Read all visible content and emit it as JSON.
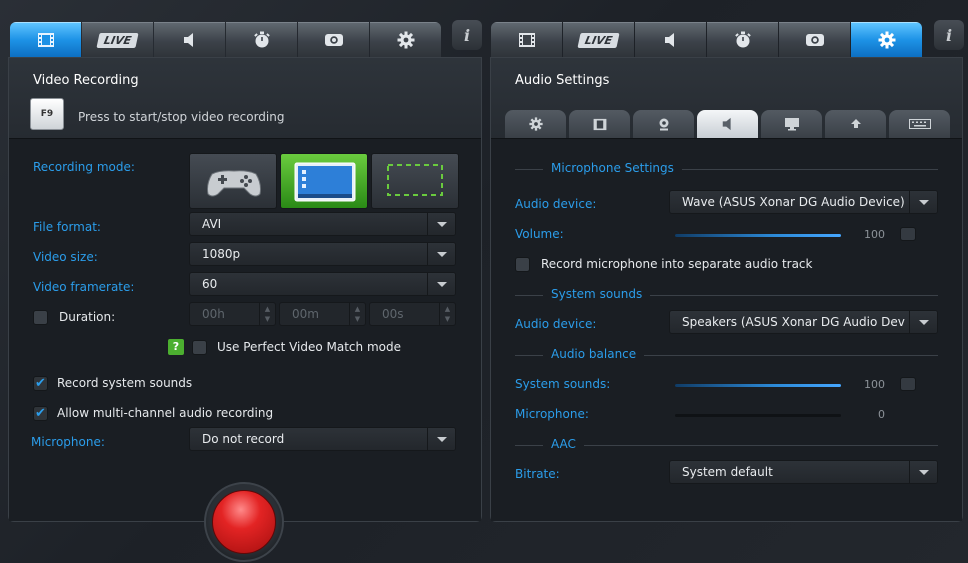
{
  "left": {
    "tabs": [
      {
        "icon": "film-icon",
        "active": true
      },
      {
        "icon": "live-icon",
        "label": "LIVE",
        "active": false
      },
      {
        "icon": "speaker-icon",
        "active": false
      },
      {
        "icon": "stopwatch-icon",
        "active": false
      },
      {
        "icon": "camera-icon",
        "active": false
      },
      {
        "icon": "gear-icon",
        "active": false
      }
    ],
    "info_label": "i",
    "title": "Video Recording",
    "hotkey": {
      "key": "F9",
      "hint": "Press to start/stop video recording"
    },
    "recording_mode": {
      "label": "Recording mode:",
      "options": [
        "game",
        "desktop",
        "region"
      ],
      "selected": "desktop"
    },
    "file_format": {
      "label": "File format:",
      "value": "AVI"
    },
    "video_size": {
      "label": "Video size:",
      "value": "1080p"
    },
    "video_framerate": {
      "label": "Video framerate:",
      "value": "60"
    },
    "duration": {
      "label": "Duration:",
      "checked": false,
      "hours": "00h",
      "minutes": "00m",
      "seconds": "00s"
    },
    "help_icon": "?",
    "perfect_match": {
      "label": "Use Perfect Video Match mode",
      "checked": false
    },
    "record_system_sounds": {
      "label": "Record system sounds",
      "checked": true
    },
    "multi_channel": {
      "label": "Allow multi-channel audio recording",
      "checked": true
    },
    "microphone": {
      "label": "Microphone:",
      "value": "Do not record"
    }
  },
  "right": {
    "tabs": [
      {
        "icon": "film-icon",
        "active": false
      },
      {
        "icon": "live-icon",
        "label": "LIVE",
        "active": false
      },
      {
        "icon": "speaker-icon",
        "active": false
      },
      {
        "icon": "stopwatch-icon",
        "active": false
      },
      {
        "icon": "camera-icon",
        "active": false
      },
      {
        "icon": "gear-icon",
        "active": true
      }
    ],
    "info_label": "i",
    "title": "Audio Settings",
    "subtabs": [
      {
        "icon": "gear-icon",
        "active": false
      },
      {
        "icon": "film-icon",
        "active": false
      },
      {
        "icon": "webcam-icon",
        "active": false
      },
      {
        "icon": "speaker-icon",
        "active": true
      },
      {
        "icon": "monitor-icon",
        "active": false
      },
      {
        "icon": "upload-icon",
        "active": false
      },
      {
        "icon": "keyboard-icon",
        "active": false
      }
    ],
    "mic_settings": {
      "section": "Microphone Settings",
      "device_label": "Audio device:",
      "device_value": "Wave (ASUS Xonar DG Audio Device)",
      "volume_label": "Volume:",
      "volume": 100,
      "separate_track": {
        "label": "Record microphone into separate audio track",
        "checked": false
      }
    },
    "system_sounds": {
      "section": "System sounds",
      "device_label": "Audio device:",
      "device_value": "Speakers (ASUS Xonar DG Audio Dev"
    },
    "audio_balance": {
      "section": "Audio balance",
      "system_label": "System sounds:",
      "system_value": 100,
      "mic_label": "Microphone:",
      "mic_value": 0
    },
    "aac": {
      "section": "AAC",
      "bitrate_label": "Bitrate:",
      "bitrate_value": "System default"
    }
  },
  "colors": {
    "accent": "#2b9dea",
    "tab_active": "#1d92e6",
    "record": "#d81d1d",
    "mode_active": "#4caf30"
  }
}
